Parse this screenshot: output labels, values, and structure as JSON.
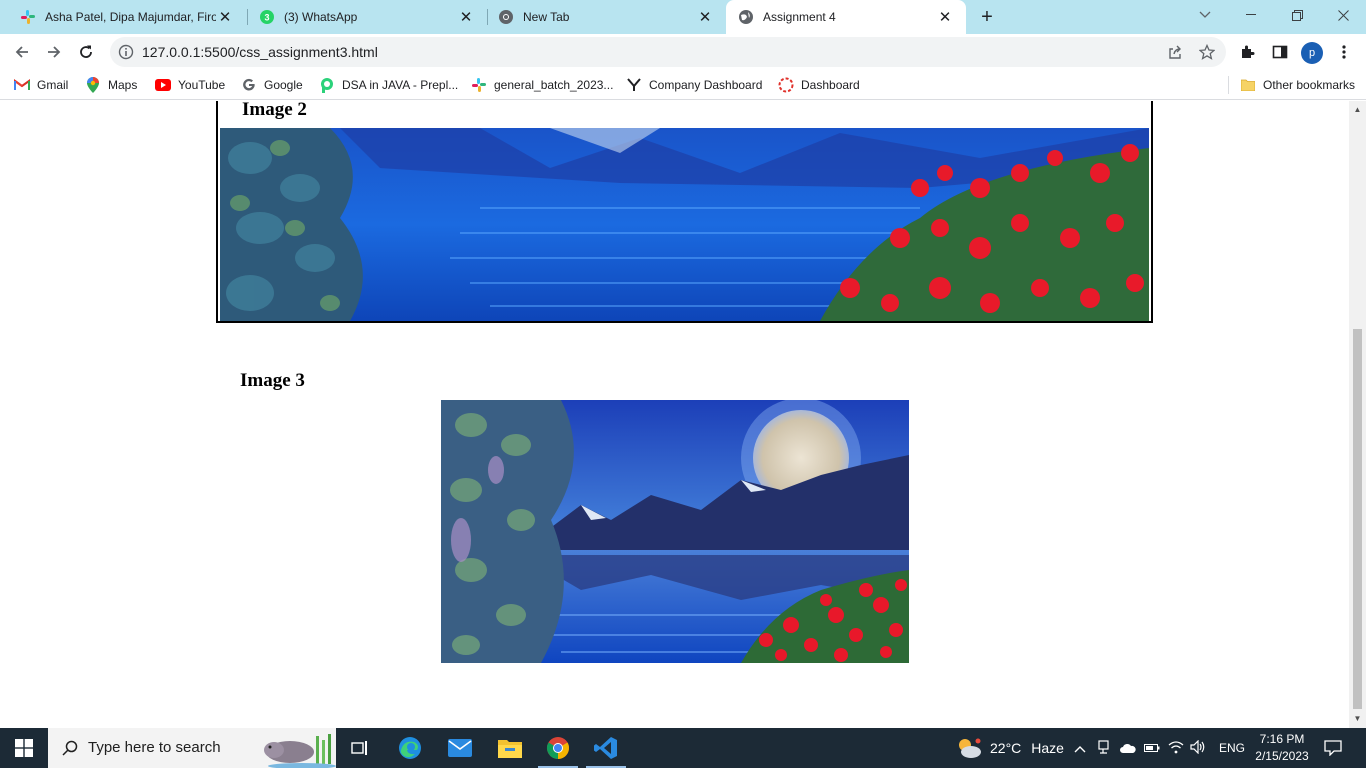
{
  "browser": {
    "tabs": [
      {
        "title": "Asha Patel, Dipa Majumdar, Firoj",
        "icon": "slack-icon",
        "active": false
      },
      {
        "title": "(3) WhatsApp",
        "icon": "whatsapp-icon",
        "active": false
      },
      {
        "title": "New Tab",
        "icon": "chrome-icon",
        "active": false
      },
      {
        "title": "Assignment 4",
        "icon": "globe-icon",
        "active": true
      }
    ],
    "url": "127.0.0.1:5500/css_assignment3.html",
    "profile_initial": "p",
    "bookmarks": [
      {
        "label": "Gmail",
        "icon": "gmail-icon"
      },
      {
        "label": "Maps",
        "icon": "maps-icon"
      },
      {
        "label": "YouTube",
        "icon": "youtube-icon"
      },
      {
        "label": "Google",
        "icon": "google-icon"
      },
      {
        "label": "DSA in JAVA - Prepl...",
        "icon": "prepinsta-icon"
      },
      {
        "label": "general_batch_2023...",
        "icon": "slack-icon"
      },
      {
        "label": "Company Dashboard",
        "icon": "y-icon"
      },
      {
        "label": "Dashboard",
        "icon": "dashboard-icon"
      }
    ],
    "other_bookmarks": "Other bookmarks"
  },
  "page": {
    "image2_heading": "Image 2",
    "image3_heading": "Image 3"
  },
  "taskbar": {
    "search_placeholder": "Type here to search",
    "weather_temp": "22°C",
    "weather_desc": "Haze",
    "language": "ENG",
    "time": "7:16 PM",
    "date": "2/15/2023"
  },
  "colors": {
    "tabstrip": "#b8e4f0",
    "taskbar": "#1c2a36",
    "lake": "#1560d8"
  }
}
